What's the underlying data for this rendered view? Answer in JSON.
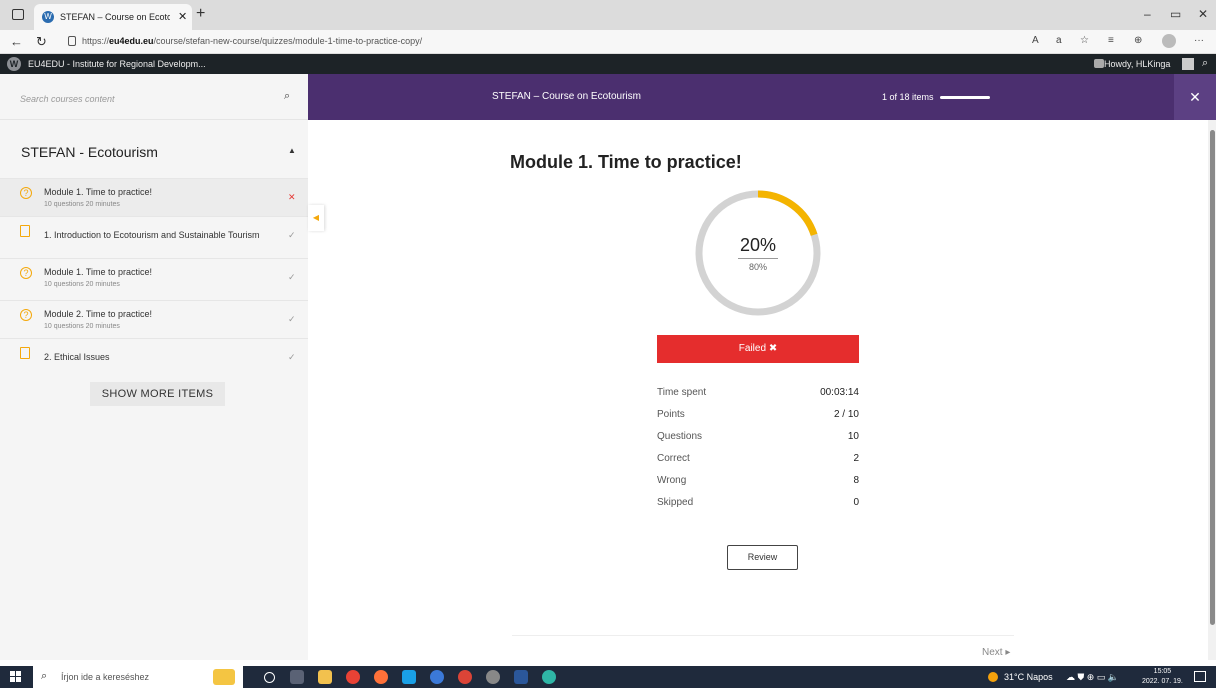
{
  "browser": {
    "tab_title": "STEFAN – Course on Ecotourism",
    "url_prefix": "https://",
    "url_domain": "eu4edu.eu",
    "url_path": "/course/stefan-new-course/quizzes/module-1-time-to-practice-copy/"
  },
  "wp_admin": {
    "site_name": "EU4EDU - Institute for Regional Developm...",
    "howdy": "Howdy, HLKinga"
  },
  "course_header": {
    "title": "STEFAN – Course on Ecotourism",
    "items_progress": "1 of 18 items",
    "progress_fraction": 0.06
  },
  "sidebar": {
    "search_placeholder": "Search courses content",
    "section_title": "STEFAN - Ecotourism",
    "items": [
      {
        "type": "quiz",
        "label": "Module 1. Time to practice!",
        "meta": "10 questions   20 minutes",
        "status": "failed"
      },
      {
        "type": "lesson",
        "label": "1. Introduction to Ecotourism and Sustainable Tourism",
        "meta": "",
        "status": "completed"
      },
      {
        "type": "quiz",
        "label": "Module 1. Time to practice!",
        "meta": "10 questions   20 minutes",
        "status": "completed"
      },
      {
        "type": "quiz",
        "label": "Module 2. Time to practice!",
        "meta": "10 questions   20 minutes",
        "status": "completed"
      },
      {
        "type": "lesson",
        "label": "2. Ethical Issues",
        "meta": "",
        "status": "completed"
      }
    ],
    "show_more_label": "SHOW MORE ITEMS"
  },
  "quiz": {
    "title": "Module 1. Time to practice!",
    "score_percent": "20%",
    "score_value": 0.2,
    "passing_grade": "80%",
    "result_label": "Failed",
    "stats": [
      {
        "label": "Time spent",
        "value": "00:03:14"
      },
      {
        "label": "Points",
        "value": "2 / 10"
      },
      {
        "label": "Questions",
        "value": "10"
      },
      {
        "label": "Correct",
        "value": "2"
      },
      {
        "label": "Wrong",
        "value": "8"
      },
      {
        "label": "Skipped",
        "value": "0"
      }
    ],
    "review_label": "Review",
    "next_label": "Next"
  },
  "colors": {
    "header_purple": "#4b2f6f",
    "accent_orange": "#f4a80c",
    "fail_red": "#e52d2d"
  },
  "taskbar": {
    "search_placeholder": "Írjon ide a kereséshez",
    "weather": "31°C  Napos",
    "time": "15:05",
    "date": "2022. 07. 19."
  }
}
